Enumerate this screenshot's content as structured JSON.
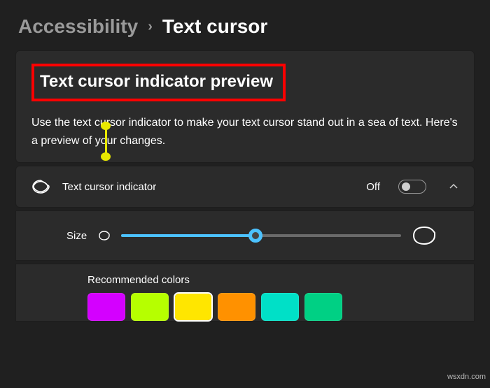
{
  "breadcrumb": {
    "parent": "Accessibility",
    "current": "Text cursor"
  },
  "preview": {
    "title": "Text cursor indicator preview",
    "description_part1": "Use the text cu",
    "description_part2": "rsor indicator to make your text cursor stand out in a sea of text. Here's a",
    "description_part3": " preview of your changes."
  },
  "indicator_row": {
    "label": "Text cursor indicator",
    "state_label": "Off",
    "toggled": false
  },
  "size_row": {
    "label": "Size",
    "value_percent": 48
  },
  "colors": {
    "label": "Recommended colors",
    "swatches": [
      "#d400ff",
      "#b6ff00",
      "#ffe600",
      "#ff9100",
      "#00e0c7",
      "#00d084"
    ],
    "selected_index": 2
  },
  "watermark": "wsxdn.com"
}
